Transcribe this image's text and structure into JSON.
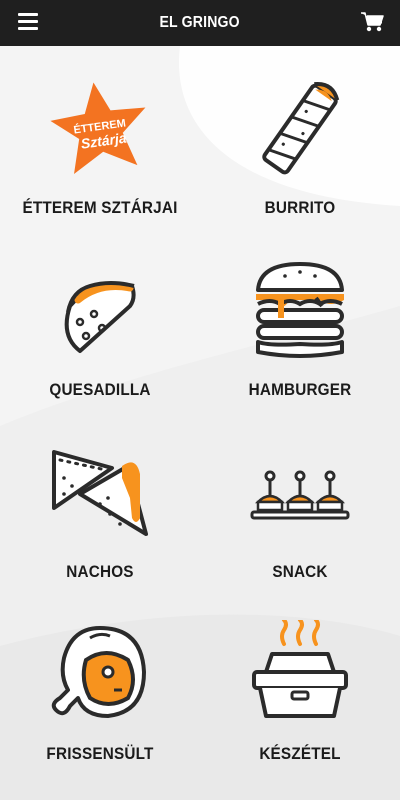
{
  "header": {
    "title": "EL GRINGO",
    "menu_icon": "hamburger-menu-icon",
    "cart_icon": "shopping-cart-icon"
  },
  "colors": {
    "header_bg": "#1f1f1f",
    "accent": "#f7931e",
    "icon_stroke": "#2b2b2b"
  },
  "badge": {
    "line1": "ÉTTEREM",
    "line2": "Sztárja"
  },
  "categories": [
    {
      "label": "ÉTTEREM SZTÁRJAI",
      "icon": "star-badge-icon"
    },
    {
      "label": "BURRITO",
      "icon": "burrito-icon"
    },
    {
      "label": "QUESADILLA",
      "icon": "quesadilla-icon"
    },
    {
      "label": "HAMBURGER",
      "icon": "hamburger-icon"
    },
    {
      "label": "NACHOS",
      "icon": "nachos-icon"
    },
    {
      "label": "SNACK",
      "icon": "snack-icon"
    },
    {
      "label": "FRISSENSÜLT",
      "icon": "fried-chicken-icon"
    },
    {
      "label": "KÉSZÉTEL",
      "icon": "ready-meal-box-icon"
    }
  ]
}
